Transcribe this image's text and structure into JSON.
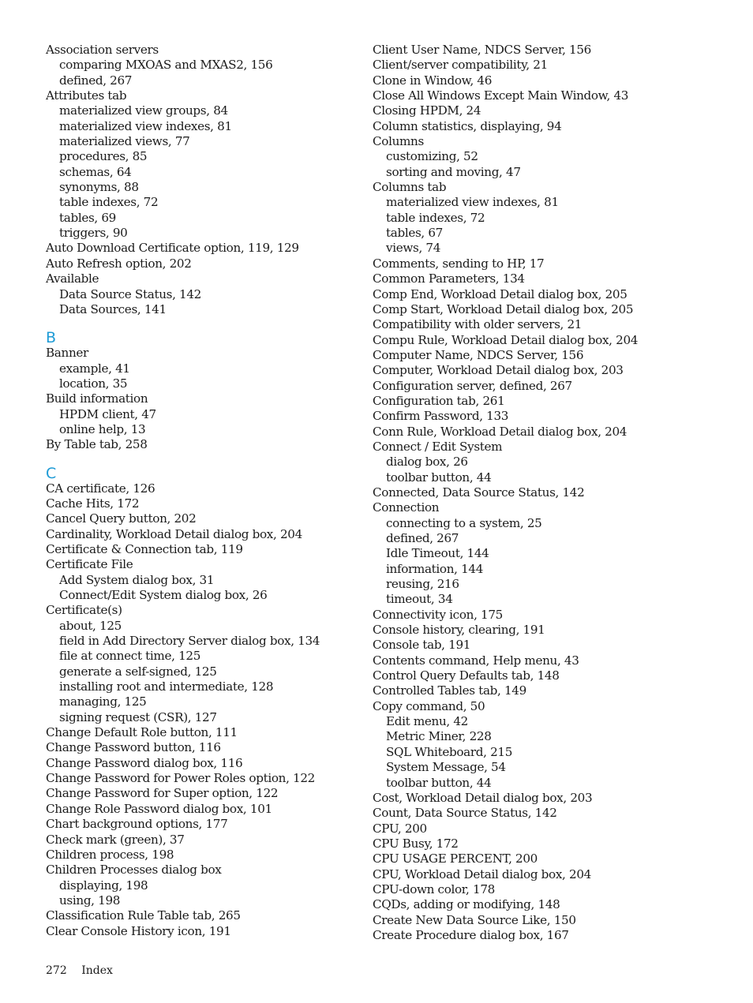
{
  "left_column": [
    {
      "type": "main",
      "text": "Association servers"
    },
    {
      "type": "sub",
      "text": "comparing MXOAS and MXAS2, 156"
    },
    {
      "type": "sub",
      "text": "defined, 267"
    },
    {
      "type": "main",
      "text": "Attributes tab"
    },
    {
      "type": "sub",
      "text": "materialized view groups, 84"
    },
    {
      "type": "sub",
      "text": "materialized view indexes, 81"
    },
    {
      "type": "sub",
      "text": "materialized views, 77"
    },
    {
      "type": "sub",
      "text": "procedures, 85"
    },
    {
      "type": "sub",
      "text": "schemas, 64"
    },
    {
      "type": "sub",
      "text": "synonyms, 88"
    },
    {
      "type": "sub",
      "text": "table indexes, 72"
    },
    {
      "type": "sub",
      "text": "tables, 69"
    },
    {
      "type": "sub",
      "text": "triggers, 90"
    },
    {
      "type": "main",
      "text": "Auto Download Certificate option, 119, 129"
    },
    {
      "type": "main",
      "text": "Auto Refresh option, 202"
    },
    {
      "type": "main",
      "text": "Available"
    },
    {
      "type": "sub",
      "text": "Data Source Status, 142"
    },
    {
      "type": "sub",
      "text": "Data Sources, 141"
    },
    {
      "type": "letter",
      "text": "B"
    },
    {
      "type": "main",
      "text": "Banner"
    },
    {
      "type": "sub",
      "text": "example, 41"
    },
    {
      "type": "sub",
      "text": "location, 35"
    },
    {
      "type": "main",
      "text": "Build information"
    },
    {
      "type": "sub",
      "text": "HPDM client, 47"
    },
    {
      "type": "sub",
      "text": "online help, 13"
    },
    {
      "type": "main",
      "text": "By Table tab, 258"
    },
    {
      "type": "letter",
      "text": "C"
    },
    {
      "type": "main",
      "text": "CA certificate, 126"
    },
    {
      "type": "main",
      "text": "Cache Hits, 172"
    },
    {
      "type": "main",
      "text": "Cancel Query button, 202"
    },
    {
      "type": "main",
      "text": "Cardinality, Workload Detail dialog box, 204"
    },
    {
      "type": "main",
      "text": "Certificate & Connection tab, 119"
    },
    {
      "type": "main",
      "text": "Certificate File"
    },
    {
      "type": "sub",
      "text": "Add System dialog box, 31"
    },
    {
      "type": "sub",
      "text": "Connect/Edit System dialog box, 26"
    },
    {
      "type": "main",
      "text": "Certificate(s)"
    },
    {
      "type": "sub",
      "text": "about, 125"
    },
    {
      "type": "sub",
      "text": "field in Add Directory Server dialog box, 134"
    },
    {
      "type": "sub",
      "text": "file at connect time, 125"
    },
    {
      "type": "sub",
      "text": "generate a self-signed, 125"
    },
    {
      "type": "sub",
      "text": "installing root and intermediate, 128"
    },
    {
      "type": "sub",
      "text": "managing, 125"
    },
    {
      "type": "sub",
      "text": "signing request (CSR), 127"
    },
    {
      "type": "main",
      "text": "Change Default Role button, 111"
    },
    {
      "type": "main",
      "text": "Change Password button, 116"
    },
    {
      "type": "main",
      "text": "Change Password dialog box, 116"
    },
    {
      "type": "main",
      "text": "Change Password for Power Roles option, 122"
    },
    {
      "type": "main",
      "text": "Change Password for Super option, 122"
    },
    {
      "type": "main",
      "text": "Change Role Password dialog box, 101"
    },
    {
      "type": "main",
      "text": "Chart background options, 177"
    },
    {
      "type": "main",
      "text": "Check mark (green), 37"
    },
    {
      "type": "main",
      "text": "Children process, 198"
    },
    {
      "type": "main",
      "text": "Children Processes dialog box"
    },
    {
      "type": "sub",
      "text": "displaying, 198"
    },
    {
      "type": "sub",
      "text": "using, 198"
    },
    {
      "type": "main",
      "text": "Classification Rule Table tab, 265"
    },
    {
      "type": "main",
      "text": "Clear Console History icon, 191"
    }
  ],
  "right_column": [
    {
      "type": "main",
      "text": "Client User Name, NDCS Server, 156"
    },
    {
      "type": "main",
      "text": "Client/server compatibility, 21"
    },
    {
      "type": "main",
      "text": "Clone in Window, 46"
    },
    {
      "type": "main",
      "text": "Close All Windows Except Main Window, 43"
    },
    {
      "type": "main",
      "text": "Closing HPDM, 24"
    },
    {
      "type": "main",
      "text": "Column statistics, displaying, 94"
    },
    {
      "type": "main",
      "text": "Columns"
    },
    {
      "type": "sub",
      "text": "customizing, 52"
    },
    {
      "type": "sub",
      "text": "sorting and moving, 47"
    },
    {
      "type": "main",
      "text": "Columns tab"
    },
    {
      "type": "sub",
      "text": "materialized view indexes, 81"
    },
    {
      "type": "sub",
      "text": "table indexes, 72"
    },
    {
      "type": "sub",
      "text": "tables, 67"
    },
    {
      "type": "sub",
      "text": "views, 74"
    },
    {
      "type": "main",
      "text": "Comments, sending to HP, 17"
    },
    {
      "type": "main",
      "text": "Common Parameters, 134"
    },
    {
      "type": "main",
      "text": "Comp End, Workload Detail dialog box, 205"
    },
    {
      "type": "main",
      "text": "Comp Start, Workload Detail dialog box, 205"
    },
    {
      "type": "main",
      "text": "Compatibility with older servers, 21"
    },
    {
      "type": "main",
      "text": "Compu Rule, Workload Detail dialog box, 204"
    },
    {
      "type": "main",
      "text": "Computer Name, NDCS Server, 156"
    },
    {
      "type": "main",
      "text": "Computer, Workload Detail dialog box, 203"
    },
    {
      "type": "main",
      "text": "Configuration server, defined, 267"
    },
    {
      "type": "main",
      "text": "Configuration tab, 261"
    },
    {
      "type": "main",
      "text": "Confirm Password, 133"
    },
    {
      "type": "main",
      "text": "Conn Rule, Workload Detail dialog box, 204"
    },
    {
      "type": "main",
      "text": "Connect / Edit System"
    },
    {
      "type": "sub",
      "text": "dialog box, 26"
    },
    {
      "type": "sub",
      "text": "toolbar button, 44"
    },
    {
      "type": "main",
      "text": "Connected, Data Source Status, 142"
    },
    {
      "type": "main",
      "text": "Connection"
    },
    {
      "type": "sub",
      "text": "connecting to a system, 25"
    },
    {
      "type": "sub",
      "text": "defined, 267"
    },
    {
      "type": "sub",
      "text": "Idle Timeout, 144"
    },
    {
      "type": "sub",
      "text": "information, 144"
    },
    {
      "type": "sub",
      "text": "reusing, 216"
    },
    {
      "type": "sub",
      "text": "timeout, 34"
    },
    {
      "type": "main",
      "text": "Connectivity icon, 175"
    },
    {
      "type": "main",
      "text": "Console history, clearing, 191"
    },
    {
      "type": "main",
      "text": "Console tab, 191"
    },
    {
      "type": "main",
      "text": "Contents command, Help menu, 43"
    },
    {
      "type": "main",
      "text": "Control Query Defaults tab, 148"
    },
    {
      "type": "main",
      "text": "Controlled Tables tab, 149"
    },
    {
      "type": "main",
      "text": "Copy command, 50"
    },
    {
      "type": "sub",
      "text": "Edit menu, 42"
    },
    {
      "type": "sub",
      "text": "Metric Miner, 228"
    },
    {
      "type": "sub",
      "text": "SQL Whiteboard, 215"
    },
    {
      "type": "sub",
      "text": "System Message, 54"
    },
    {
      "type": "sub",
      "text": "toolbar button, 44"
    },
    {
      "type": "main",
      "text": "Cost, Workload Detail dialog box, 203"
    },
    {
      "type": "main",
      "text": "Count, Data Source Status, 142"
    },
    {
      "type": "main",
      "text": "CPU, 200"
    },
    {
      "type": "main",
      "text": "CPU Busy, 172"
    },
    {
      "type": "main",
      "text": "CPU USAGE PERCENT, 200"
    },
    {
      "type": "main",
      "text": "CPU, Workload Detail dialog box, 204"
    },
    {
      "type": "main",
      "text": "CPU-down color, 178"
    },
    {
      "type": "main",
      "text": "CQDs, adding or modifying, 148"
    },
    {
      "type": "main",
      "text": "Create New Data Source Like, 150"
    },
    {
      "type": "main",
      "text": "Create Procedure dialog box, 167"
    }
  ],
  "footer": {
    "page_number": "272",
    "section": "Index"
  },
  "colors": {
    "letter_heading": "#1e9bd6",
    "text": "#1a1a1a"
  }
}
